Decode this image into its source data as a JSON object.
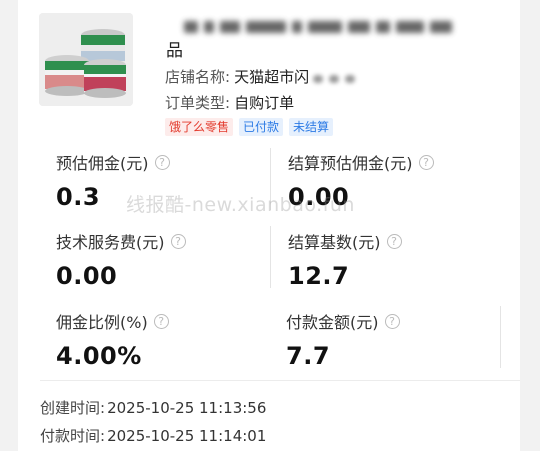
{
  "product": {
    "title_tail": "品",
    "shop_label": "店铺名称:",
    "shop_value": "天猫超市闪",
    "order_type_label": "订单类型:",
    "order_type_value": "自购订单",
    "tags": [
      "饿了么零售",
      "已付款",
      "未结算"
    ]
  },
  "metrics": {
    "est_commission": {
      "label": "预估佣金(元)",
      "value": "0.3"
    },
    "settle_est_commission": {
      "label": "结算预估佣金(元)",
      "value": "0.00"
    },
    "service_fee": {
      "label": "技术服务费(元)",
      "value": "0.00"
    },
    "settle_base": {
      "label": "结算基数(元)",
      "value": "12.7"
    },
    "commission_rate": {
      "label": "佣金比例(%)",
      "value": "4.00%"
    },
    "payment_amount": {
      "label": "付款金额(元)",
      "value": "7.7"
    }
  },
  "times": {
    "created_label": "创建时间:",
    "created_value": "2025-10-25 11:13:56",
    "paid_label": "付款时间:",
    "paid_value": "2025-10-25 11:14:01"
  },
  "watermark": "线报酷-new.xianbao.fun",
  "colors": {
    "tag_red": "#e33b2e",
    "tag_blue": "#2d7be5"
  }
}
